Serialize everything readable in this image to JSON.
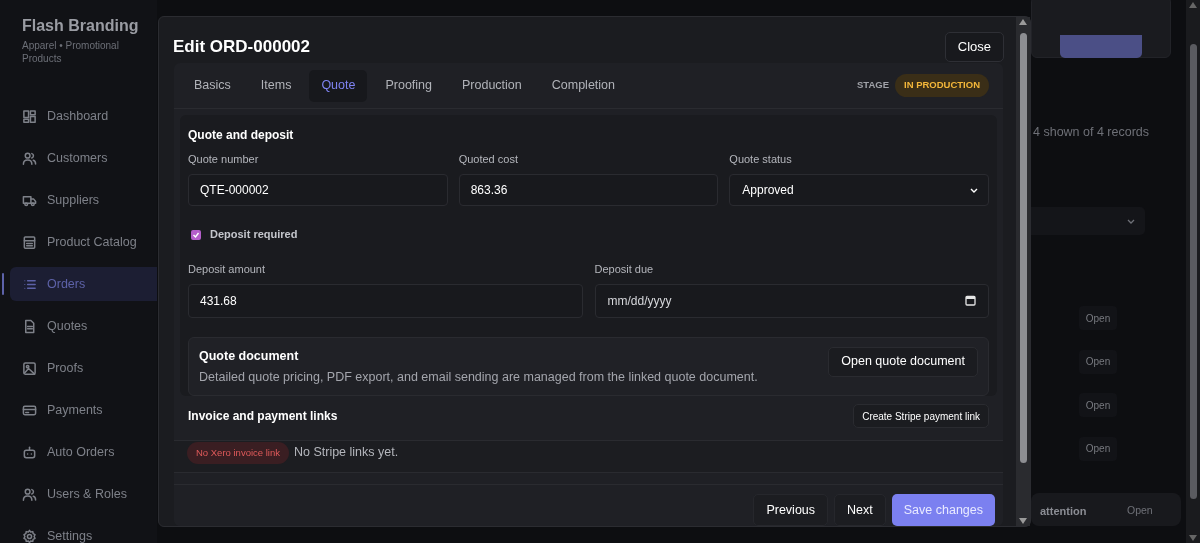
{
  "sidebar": {
    "brand": "Flash Branding",
    "subtitle": "Apparel • Promotional Products",
    "items": [
      {
        "label": "Dashboard",
        "selected": false
      },
      {
        "label": "Customers",
        "selected": false
      },
      {
        "label": "Suppliers",
        "selected": false
      },
      {
        "label": "Product Catalog",
        "selected": false
      },
      {
        "label": "Orders",
        "selected": true
      },
      {
        "label": "Quotes",
        "selected": false
      },
      {
        "label": "Proofs",
        "selected": false
      },
      {
        "label": "Payments",
        "selected": false
      },
      {
        "label": "Auto Orders",
        "selected": false
      },
      {
        "label": "Users & Roles",
        "selected": false
      },
      {
        "label": "Settings",
        "selected": false
      }
    ]
  },
  "background": {
    "records_text": "4 shown of 4 records",
    "row_actions": [
      "Open",
      "Open",
      "Open",
      "Open"
    ],
    "alert_text": "attention",
    "alert_action": "Open"
  },
  "modal": {
    "title": "Edit ORD-000002",
    "close_label": "Close",
    "tabs": [
      {
        "label": "Basics",
        "selected": false
      },
      {
        "label": "Items",
        "selected": false
      },
      {
        "label": "Quote",
        "selected": true
      },
      {
        "label": "Proofing",
        "selected": false
      },
      {
        "label": "Production",
        "selected": false
      },
      {
        "label": "Completion",
        "selected": false
      }
    ],
    "stage_label": "STAGE",
    "stage_badge": "IN PRODUCTION",
    "quote_section": {
      "title": "Quote and deposit",
      "fields": [
        {
          "label": "Quote number",
          "value": "QTE-000002",
          "kind": "text"
        },
        {
          "label": "Quoted cost",
          "value": "863.36",
          "kind": "text"
        },
        {
          "label": "Quote status",
          "value": "Approved",
          "kind": "select"
        }
      ],
      "deposit_required": {
        "label": "Deposit required",
        "checked": true
      },
      "deposit_fields": [
        {
          "label": "Deposit amount",
          "value": "431.68",
          "kind": "text"
        },
        {
          "label": "Deposit due",
          "placeholder": "mm/dd/yyyy",
          "kind": "date"
        }
      ],
      "document": {
        "title": "Quote document",
        "description": "Detailed quote pricing, PDF export, and email sending are managed from the linked quote document.",
        "button": "Open quote document"
      }
    },
    "invoice_section": {
      "title": "Invoice and payment links",
      "button": "Create Stripe payment link",
      "badge": "No Xero invoice link",
      "message": "No Stripe links yet."
    },
    "footer_buttons": [
      {
        "label": "Previous",
        "kind": "secondary"
      },
      {
        "label": "Next",
        "kind": "secondary"
      },
      {
        "label": "Save changes",
        "kind": "primary"
      }
    ]
  }
}
